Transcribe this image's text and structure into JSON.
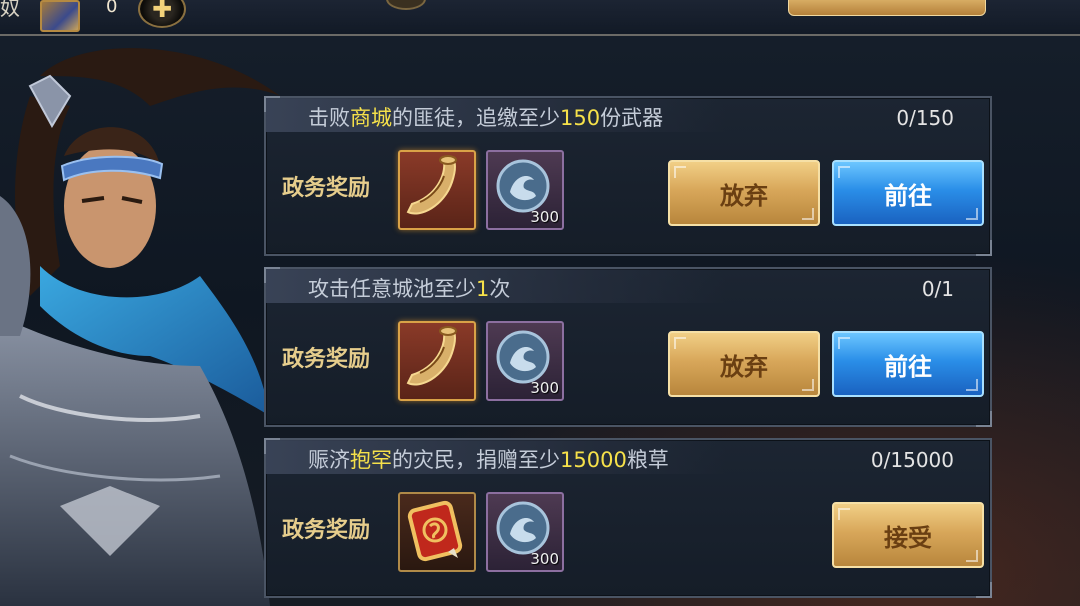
{
  "topbar": {
    "left_char": "奴",
    "item_count": "0",
    "add_icon": "plus-icon"
  },
  "quests": [
    {
      "text_parts": [
        "击败",
        "商城",
        "的匪徒，追缴至少",
        "150",
        "份武器"
      ],
      "progress": "0/150",
      "reward_label": "政务奖励",
      "reward_icons": [
        "horn-icon",
        "dragon-coin-icon"
      ],
      "coin_count": "300",
      "buttons": {
        "abandon": "放弃",
        "go": "前往"
      }
    },
    {
      "text_parts": [
        "攻击任意城池至少",
        "1",
        "次"
      ],
      "progress": "0/1",
      "reward_label": "政务奖励",
      "reward_icons": [
        "horn-icon",
        "dragon-coin-icon"
      ],
      "coin_count": "300",
      "buttons": {
        "abandon": "放弃",
        "go": "前往"
      }
    },
    {
      "text_parts": [
        "赈济",
        "抱罕",
        "的灾民，捐赠至少",
        "15000",
        "粮草"
      ],
      "progress": "0/15000",
      "reward_label": "政务奖励",
      "reward_icons": [
        "token-icon",
        "dragon-coin-icon"
      ],
      "coin_count": "300",
      "buttons": {
        "accept": "接受"
      }
    }
  ],
  "colors": {
    "highlight": "#f6e14a",
    "gold_button": "#d8a75a",
    "blue_button": "#2a8ee8",
    "reward_label": "#e6cd8c"
  }
}
